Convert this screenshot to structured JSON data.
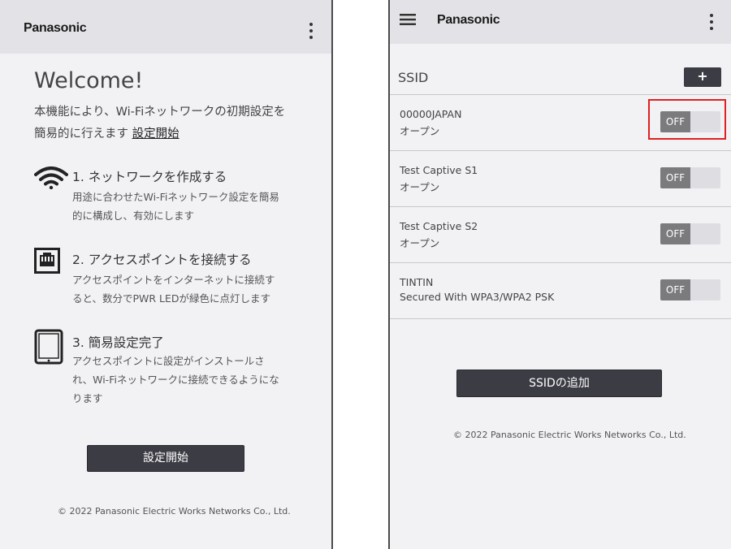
{
  "left_screen": {
    "brand": "Panasonic",
    "welcome_title": "Welcome!",
    "intro_line1": "本機能により、Wi-Fiネットワークの初期設定を",
    "intro_line2": "簡易的に行えます",
    "intro_link": "設定開始",
    "steps": [
      {
        "icon": "wifi-icon",
        "title": "1. ネットワークを作成する",
        "desc_line1": "用途に合わせたWi-Fiネットワーク設定を簡易",
        "desc_line2": "的に構成し、有効にします",
        "desc_line3": ""
      },
      {
        "icon": "ethernet-port-icon",
        "title": "2. アクセスポイントを接続する",
        "desc_line1": "アクセスポイントをインターネットに接続す",
        "desc_line2": "ると、数分でPWR LEDが緑色に点灯します",
        "desc_line3": ""
      },
      {
        "icon": "tablet-icon",
        "title": "3. 簡易設定完了",
        "desc_line1": "アクセスポイントに設定がインストールさ",
        "desc_line2": "れ、Wi-Fiネットワークに接続できるようにな",
        "desc_line3": "ります"
      }
    ],
    "start_button": "設定開始",
    "copyright": "© 2022 Panasonic Electric Works Networks Co., Ltd."
  },
  "right_screen": {
    "brand": "Panasonic",
    "ssid_header": "SSID",
    "add_plus": "+",
    "ssids": [
      {
        "name": "00000JAPAN",
        "security": "オープン",
        "toggle": "OFF",
        "highlighted": true
      },
      {
        "name": "Test Captive S1",
        "security": "オープン",
        "toggle": "OFF",
        "highlighted": false
      },
      {
        "name": "Test Captive S2",
        "security": "オープン",
        "toggle": "OFF",
        "highlighted": false
      },
      {
        "name": "TINTIN",
        "security": "Secured With WPA3/WPA2 PSK",
        "toggle": "OFF",
        "highlighted": false
      }
    ],
    "add_ssid_button": "SSIDの追加",
    "copyright": "© 2022 Panasonic Electric Works Networks Co., Ltd."
  },
  "colors": {
    "button_dark": "#3c3c45",
    "toggle_off_knob": "#7b7b7e",
    "highlight_border": "#e02020"
  }
}
